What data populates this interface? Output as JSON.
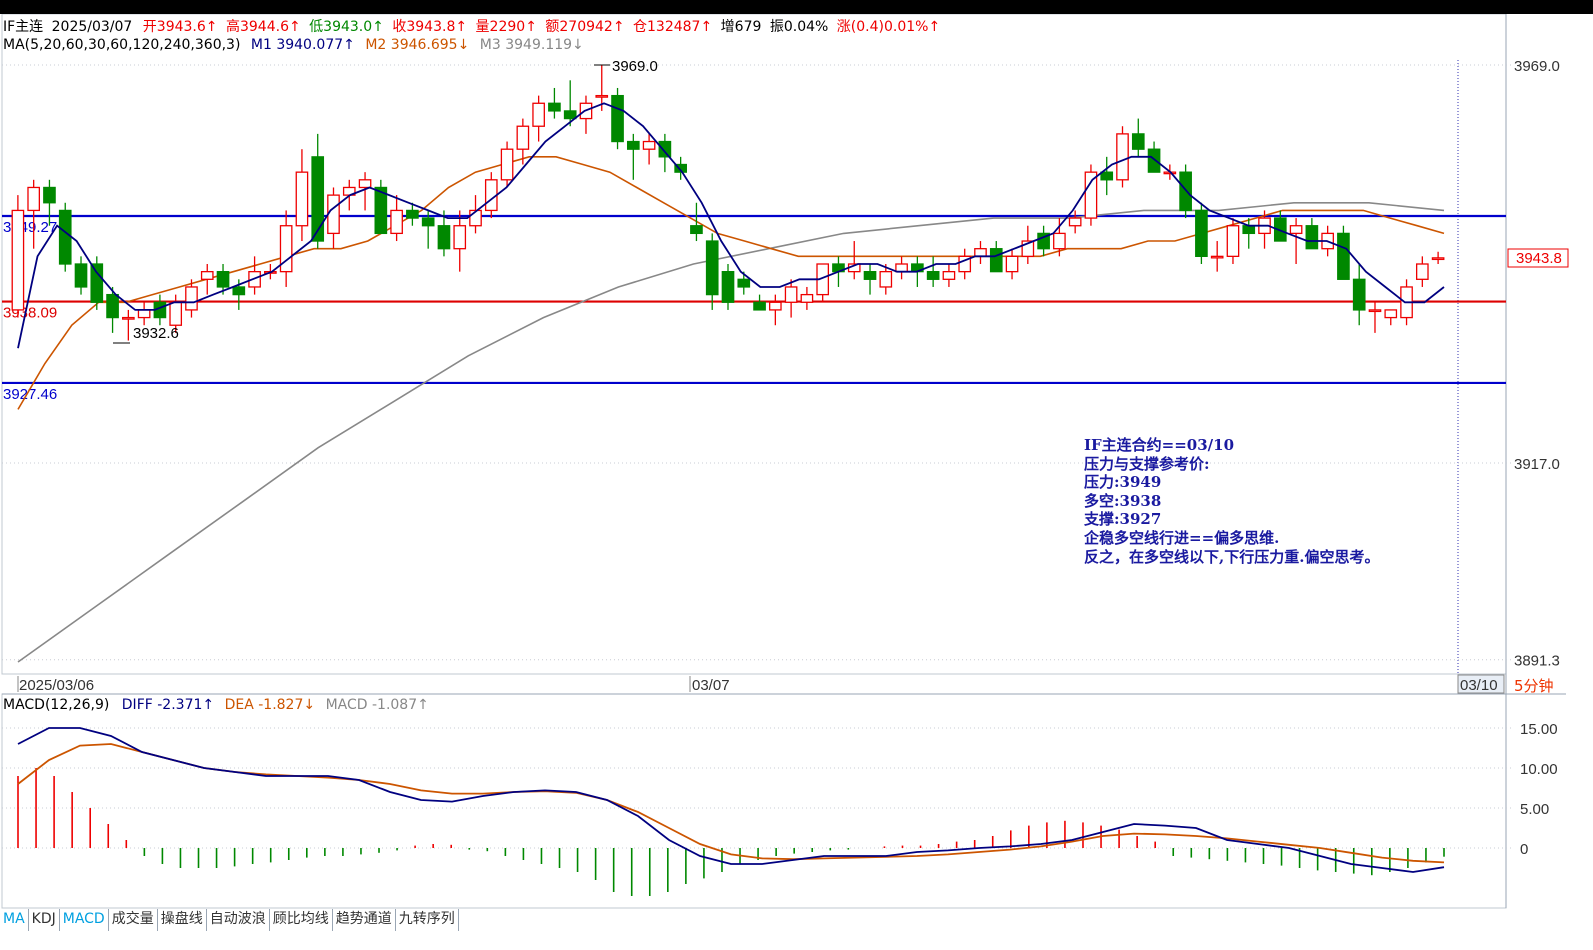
{
  "header": {
    "symbol": "IF主连",
    "date": "2025/03/07",
    "open_label": "开",
    "open": "3943.6",
    "high_label": "高",
    "high": "3944.6",
    "low_label": "低",
    "low": "3943.0",
    "close_label": "收",
    "close": "3943.8",
    "volume_label": "量",
    "volume": "2290",
    "amount_label": "额",
    "amount": "270942",
    "oi_label": "仓",
    "oi": "132487",
    "inc_label": "增",
    "inc": "679",
    "amp_label": "振",
    "amp": "0.04%",
    "chg_label": "涨",
    "chg": "(0.4)0.01%",
    "up_arrow": "↑",
    "down_arrow": "↓"
  },
  "ma_line": {
    "title": "MA(5,20,60,30,60,120,240,360,3)",
    "m1_label": "M1",
    "m1": "3940.077",
    "m2_label": "M2",
    "m2": "3946.695",
    "m3_label": "M3",
    "m3": "3949.119"
  },
  "macd_line": {
    "title": "MACD(12,26,9)",
    "diff_label": "DIFF",
    "diff": "-2.371",
    "dea_label": "DEA",
    "dea": "-1.827",
    "macd_label": "MACD",
    "macd": "-1.087"
  },
  "price_axis": [
    "3969.0",
    "3917.0",
    "3891.3"
  ],
  "price_tag": "3943.8",
  "macd_axis": [
    "15.00",
    "10.00",
    "5.00",
    "0"
  ],
  "date_axis": [
    "2025/03/06",
    "03/07",
    "03/10"
  ],
  "period": "5分钟",
  "levels": [
    {
      "label": "3949.27",
      "value": 3949.27,
      "color": "#0000cc"
    },
    {
      "label": "3938.09",
      "value": 3938.09,
      "color": "#dd0000"
    },
    {
      "label": "3927.46",
      "value": 3927.46,
      "color": "#0000cc"
    }
  ],
  "annotations": {
    "high_label": "3969.0",
    "low_label": "3932.6"
  },
  "note": [
    "IF主连合约==03/10",
    "压力与支撑参考价:",
    "压力:3949",
    "多空:3938",
    "支撑:3927",
    "企稳多空线行进==偏多思维.",
    "反之，在多空线以下,下行压力重.偏空思考。"
  ],
  "tabs": [
    "MA",
    "KDJ",
    "MACD",
    "成交量",
    "操盘线",
    "自动波浪",
    "顾比均线",
    "趋势通道",
    "九转序列"
  ],
  "colors": {
    "up": "#ee0000",
    "down": "#008800",
    "m1": "#000080",
    "m2": "#cc5500",
    "m3": "#888888"
  },
  "chart_data": [
    {
      "type": "candlestick",
      "title": "IF主连",
      "period": "5分钟",
      "ylim": [
        3891.3,
        3969.0
      ],
      "candles_ohlc": [
        [
          3937,
          3952,
          3936,
          3950
        ],
        [
          3950,
          3954,
          3945,
          3953
        ],
        [
          3953,
          3954,
          3948,
          3951
        ],
        [
          3950,
          3951,
          3942,
          3943
        ],
        [
          3943,
          3944,
          3939,
          3940
        ],
        [
          3943,
          3944,
          3937,
          3938
        ],
        [
          3939,
          3940,
          3934,
          3936
        ],
        [
          3936,
          3937,
          3933,
          3936
        ],
        [
          3936,
          3938,
          3935,
          3937
        ],
        [
          3938,
          3939,
          3935,
          3936
        ],
        [
          3935,
          3939,
          3934,
          3938
        ],
        [
          3937,
          3941,
          3936,
          3940
        ],
        [
          3941,
          3943,
          3939,
          3942
        ],
        [
          3942,
          3943,
          3939,
          3940
        ],
        [
          3940,
          3941,
          3937,
          3939
        ],
        [
          3940,
          3944,
          3939,
          3942
        ],
        [
          3942,
          3943,
          3941,
          3942
        ],
        [
          3942,
          3950,
          3940,
          3948
        ],
        [
          3948,
          3958,
          3946,
          3955
        ],
        [
          3957,
          3960,
          3945,
          3946
        ],
        [
          3947,
          3953,
          3945,
          3952
        ],
        [
          3952,
          3954,
          3950,
          3953
        ],
        [
          3953,
          3955,
          3950,
          3954
        ],
        [
          3953,
          3954,
          3947,
          3947
        ],
        [
          3947,
          3952,
          3946,
          3950
        ],
        [
          3950,
          3951,
          3948,
          3949
        ],
        [
          3949,
          3950,
          3945,
          3948
        ],
        [
          3948,
          3950,
          3944,
          3945
        ],
        [
          3945,
          3950,
          3942,
          3948
        ],
        [
          3948,
          3952,
          3947,
          3950
        ],
        [
          3950,
          3955,
          3949,
          3954
        ],
        [
          3954,
          3959,
          3953,
          3958
        ],
        [
          3958,
          3962,
          3956,
          3961
        ],
        [
          3961,
          3965,
          3959,
          3964
        ],
        [
          3964,
          3966,
          3962,
          3963
        ],
        [
          3963,
          3967,
          3961,
          3962
        ],
        [
          3962,
          3965,
          3960,
          3964
        ],
        [
          3965,
          3969,
          3963,
          3965
        ],
        [
          3965,
          3966,
          3958,
          3959
        ],
        [
          3959,
          3960,
          3954,
          3958
        ],
        [
          3958,
          3960,
          3956,
          3959
        ],
        [
          3959,
          3960,
          3955,
          3957
        ],
        [
          3956,
          3957,
          3954,
          3955
        ],
        [
          3948,
          3951,
          3946,
          3947
        ],
        [
          3946,
          3947,
          3937,
          3939
        ],
        [
          3942,
          3943,
          3937,
          3938
        ],
        [
          3941,
          3942,
          3939,
          3940
        ],
        [
          3938,
          3939,
          3937,
          3937
        ],
        [
          3937,
          3939,
          3935,
          3938
        ],
        [
          3938,
          3941,
          3936,
          3940
        ],
        [
          3938,
          3940,
          3937,
          3939
        ],
        [
          3939,
          3943,
          3938,
          3943
        ],
        [
          3943,
          3944,
          3940,
          3942
        ],
        [
          3942,
          3946,
          3941,
          3943
        ],
        [
          3942,
          3943,
          3939,
          3941
        ],
        [
          3940,
          3943,
          3939,
          3942
        ],
        [
          3942,
          3944,
          3941,
          3943
        ],
        [
          3943,
          3944,
          3940,
          3942
        ],
        [
          3942,
          3944,
          3940,
          3941
        ],
        [
          3941,
          3943,
          3940,
          3942
        ],
        [
          3942,
          3945,
          3941,
          3944
        ],
        [
          3944,
          3946,
          3943,
          3945
        ],
        [
          3945,
          3946,
          3942,
          3942
        ],
        [
          3942,
          3945,
          3941,
          3944
        ],
        [
          3944,
          3948,
          3943,
          3946
        ],
        [
          3947,
          3948,
          3944,
          3945
        ],
        [
          3945,
          3949,
          3944,
          3947
        ],
        [
          3948,
          3950,
          3947,
          3949
        ],
        [
          3949,
          3956,
          3948,
          3955
        ],
        [
          3955,
          3957,
          3952,
          3954
        ],
        [
          3954,
          3961,
          3953,
          3960
        ],
        [
          3960,
          3962,
          3957,
          3958
        ],
        [
          3958,
          3959,
          3955,
          3955
        ],
        [
          3955,
          3956,
          3954,
          3955
        ],
        [
          3955,
          3956,
          3949,
          3950
        ],
        [
          3950,
          3951,
          3943,
          3944
        ],
        [
          3944,
          3946,
          3942,
          3944
        ],
        [
          3944,
          3949,
          3943,
          3948
        ],
        [
          3948,
          3949,
          3945,
          3947
        ],
        [
          3947,
          3950,
          3945,
          3949
        ],
        [
          3949,
          3950,
          3946,
          3946
        ],
        [
          3947,
          3949,
          3943,
          3948
        ],
        [
          3948,
          3949,
          3945,
          3945
        ],
        [
          3945,
          3948,
          3944,
          3947
        ],
        [
          3947,
          3948,
          3941,
          3941
        ],
        [
          3941,
          3943,
          3935,
          3937
        ],
        [
          3937,
          3938,
          3934,
          3937
        ],
        [
          3936,
          3937,
          3935,
          3937
        ],
        [
          3936,
          3941,
          3935,
          3940
        ],
        [
          3941,
          3944,
          3940,
          3943
        ],
        [
          3943.6,
          3944.6,
          3943.0,
          3943.8
        ]
      ],
      "series": [
        {
          "name": "M1",
          "values": [
            3932,
            3944,
            3948,
            3946,
            3942,
            3939,
            3937,
            3937,
            3938,
            3938,
            3939,
            3940,
            3941,
            3942,
            3944,
            3946,
            3950,
            3952,
            3953,
            3952,
            3951,
            3950,
            3949,
            3949,
            3951,
            3953,
            3956,
            3959,
            3961,
            3963,
            3964,
            3963,
            3961,
            3958,
            3955,
            3951,
            3946,
            3942,
            3940,
            3940,
            3941,
            3941,
            3942,
            3943,
            3943,
            3942,
            3942,
            3943,
            3943,
            3944,
            3944,
            3945,
            3946,
            3947,
            3950,
            3954,
            3956,
            3957,
            3957,
            3955,
            3952,
            3950,
            3949,
            3948,
            3948,
            3947,
            3946,
            3946,
            3945,
            3942,
            3940,
            3938,
            3938,
            3940
          ]
        },
        {
          "name": "M2",
          "values": [
            3924,
            3930,
            3935,
            3938,
            3938,
            3939,
            3940,
            3941,
            3942,
            3943,
            3944,
            3945,
            3945,
            3946,
            3948,
            3950,
            3953,
            3955,
            3956,
            3957,
            3957,
            3956,
            3955,
            3953,
            3951,
            3949,
            3947,
            3946,
            3945,
            3944,
            3944,
            3944,
            3944,
            3944,
            3944,
            3944,
            3944,
            3944,
            3944,
            3945,
            3945,
            3945,
            3946,
            3946,
            3947,
            3948,
            3949,
            3950,
            3950,
            3950,
            3950,
            3949,
            3948,
            3947
          ]
        },
        {
          "name": "M3",
          "values": [
            3891,
            3898,
            3905,
            3912,
            3919,
            3925,
            3931,
            3936,
            3940,
            3943,
            3945,
            3947,
            3948,
            3949,
            3949,
            3950,
            3950,
            3951,
            3951,
            3950
          ]
        },
        {
          "name": "3949.27",
          "values": [
            3949.27
          ]
        },
        {
          "name": "3938.09",
          "values": [
            3938.09
          ]
        },
        {
          "name": "3927.46",
          "values": [
            3927.46
          ]
        }
      ]
    },
    {
      "type": "line",
      "title": "MACD(12,26,9)",
      "ylim": [
        -5,
        17
      ],
      "series": [
        {
          "name": "DIFF",
          "values": [
            13,
            15,
            15,
            14,
            12,
            11,
            10,
            9.5,
            9,
            9,
            9,
            8.5,
            7,
            6,
            5.8,
            6.5,
            7,
            7.2,
            7,
            6,
            4,
            1,
            -1,
            -2,
            -2,
            -1.5,
            -1,
            -1,
            -1,
            -0.5,
            -0.3,
            0,
            0.2,
            0.5,
            1,
            2,
            3,
            2.8,
            2.5,
            1,
            0.5,
            0,
            -1,
            -2,
            -2.5,
            -3,
            -2.4
          ]
        },
        {
          "name": "DEA",
          "values": [
            8,
            11,
            12.8,
            13,
            12,
            11,
            10,
            9.5,
            9.2,
            9,
            8.8,
            8.5,
            8,
            7.2,
            6.8,
            6.8,
            7,
            7.1,
            6.9,
            6,
            4.5,
            2.5,
            0.5,
            -0.8,
            -1.3,
            -1.4,
            -1.3,
            -1.2,
            -1.1,
            -1,
            -0.8,
            -0.5,
            -0.2,
            0.2,
            0.8,
            1.5,
            1.8,
            1.7,
            1.5,
            1.2,
            0.8,
            0.4,
            0,
            -0.6,
            -1.2,
            -1.6,
            -1.8
          ]
        },
        {
          "name": "MACD",
          "values": [
            9,
            10,
            9,
            7,
            5,
            3,
            1,
            -1,
            -2,
            -2.5,
            -2.5,
            -2.5,
            -2.3,
            -2,
            -1.8,
            -1.5,
            -1.2,
            -1,
            -1,
            -0.8,
            -0.6,
            -0.3,
            0.3,
            0.5,
            0.4,
            -0.2,
            -0.4,
            -1,
            -1.5,
            -2,
            -2.5,
            -3,
            -4,
            -5.5,
            -6,
            -6,
            -5.5,
            -4.5,
            -3.8,
            -3,
            -2,
            -1.5,
            -1,
            -0.7,
            -0.5,
            -0.3,
            -0.2,
            0,
            0.2,
            0.3,
            0.3,
            0.5,
            0.8,
            1,
            1.5,
            2.2,
            2.8,
            3.2,
            3.4,
            3.2,
            2.8,
            2.3,
            1.5,
            0.8,
            -1,
            -1.2,
            -1.4,
            -1.6,
            -1.8,
            -2,
            -2.2,
            -2.5,
            -2.8,
            -3,
            -3.2,
            -3.4,
            -3,
            -2.5,
            -1.8,
            -1.087
          ]
        }
      ]
    }
  ]
}
